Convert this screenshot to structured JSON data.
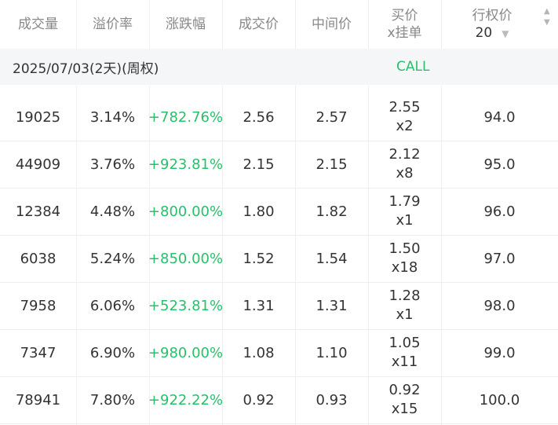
{
  "header": {
    "volume": "成交量",
    "premium": "溢价率",
    "change": "涨跌幅",
    "last": "成交价",
    "mid": "中间价",
    "bid_line1": "买价",
    "bid_line2": "x挂单",
    "strike_line1": "行权价",
    "strike_count": "20"
  },
  "group": {
    "expiry": "2025/07/03(2天)(周权)",
    "side": "CALL"
  },
  "rows": [
    {
      "volume": "19025",
      "premium": "3.14%",
      "change": "+782.76%",
      "last": "2.56",
      "mid": "2.57",
      "bid": "2.55",
      "bid_size": "x2",
      "strike": "94.0"
    },
    {
      "volume": "44909",
      "premium": "3.76%",
      "change": "+923.81%",
      "last": "2.15",
      "mid": "2.15",
      "bid": "2.12",
      "bid_size": "x8",
      "strike": "95.0"
    },
    {
      "volume": "12384",
      "premium": "4.48%",
      "change": "+800.00%",
      "last": "1.80",
      "mid": "1.82",
      "bid": "1.79",
      "bid_size": "x1",
      "strike": "96.0"
    },
    {
      "volume": "6038",
      "premium": "5.24%",
      "change": "+850.00%",
      "last": "1.52",
      "mid": "1.54",
      "bid": "1.50",
      "bid_size": "x18",
      "strike": "97.0"
    },
    {
      "volume": "7958",
      "premium": "6.06%",
      "change": "+523.81%",
      "last": "1.31",
      "mid": "1.31",
      "bid": "1.28",
      "bid_size": "x1",
      "strike": "98.0"
    },
    {
      "volume": "7347",
      "premium": "6.90%",
      "change": "+980.00%",
      "last": "1.08",
      "mid": "1.10",
      "bid": "1.05",
      "bid_size": "x11",
      "strike": "99.0"
    },
    {
      "volume": "78941",
      "premium": "7.80%",
      "change": "+922.22%",
      "last": "0.92",
      "mid": "0.93",
      "bid": "0.92",
      "bid_size": "x15",
      "strike": "100.0"
    }
  ],
  "colors": {
    "positive": "#27c06a",
    "header_text": "#888888",
    "group_bg": "#f5f6f7"
  }
}
